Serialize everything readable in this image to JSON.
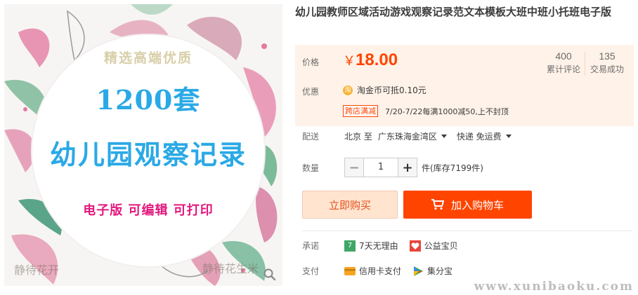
{
  "product": {
    "title": "幼儿园教师区域活动游戏观察记录范文本模板大班中班小托班电子版"
  },
  "image": {
    "top_text": "精选高端优质",
    "count_text": "1200套",
    "main_text": "幼儿园观察记录",
    "sub_text": "电子版 可编辑 可打印",
    "faint_text_left": "静待花开",
    "faint_text_right": "静待花生米",
    "zoom_icon": "magnifier-icon"
  },
  "price": {
    "label": "价格",
    "currency": "￥",
    "value": "18.00",
    "reviews_count": "400",
    "reviews_label": "累计评论",
    "deals_count": "135",
    "deals_label": "交易成功"
  },
  "promo": {
    "label": "优惠",
    "coin_icon_text": "淘",
    "coin_text_prefix": "淘金币可抵",
    "coin_amount": "0.10元",
    "tag": "跨店满减",
    "text": "7/20-7/22每满1000减50,上不封顶"
  },
  "shipping": {
    "label": "配送",
    "from": "北京 至",
    "to": "广东珠海金湾区",
    "method": "快递 免运费"
  },
  "quantity": {
    "label": "数量",
    "value": "1",
    "minus": "−",
    "plus": "+",
    "stock": "件(库存7199件)"
  },
  "buttons": {
    "buy_now": "立即购买",
    "add_cart": "加入购物车"
  },
  "promise": {
    "label": "承诺",
    "item1": "7天无理由",
    "item1_icon": "7",
    "item2": "公益宝贝"
  },
  "payment": {
    "label": "支付",
    "item1": "信用卡支付",
    "item2": "集分宝"
  },
  "watermark": "www.xunibaoku.com",
  "colors": {
    "accent": "#ff4400",
    "price_bg": "#fff2e8",
    "image_blue": "#2aa9e6",
    "image_pink": "#e2197e"
  }
}
